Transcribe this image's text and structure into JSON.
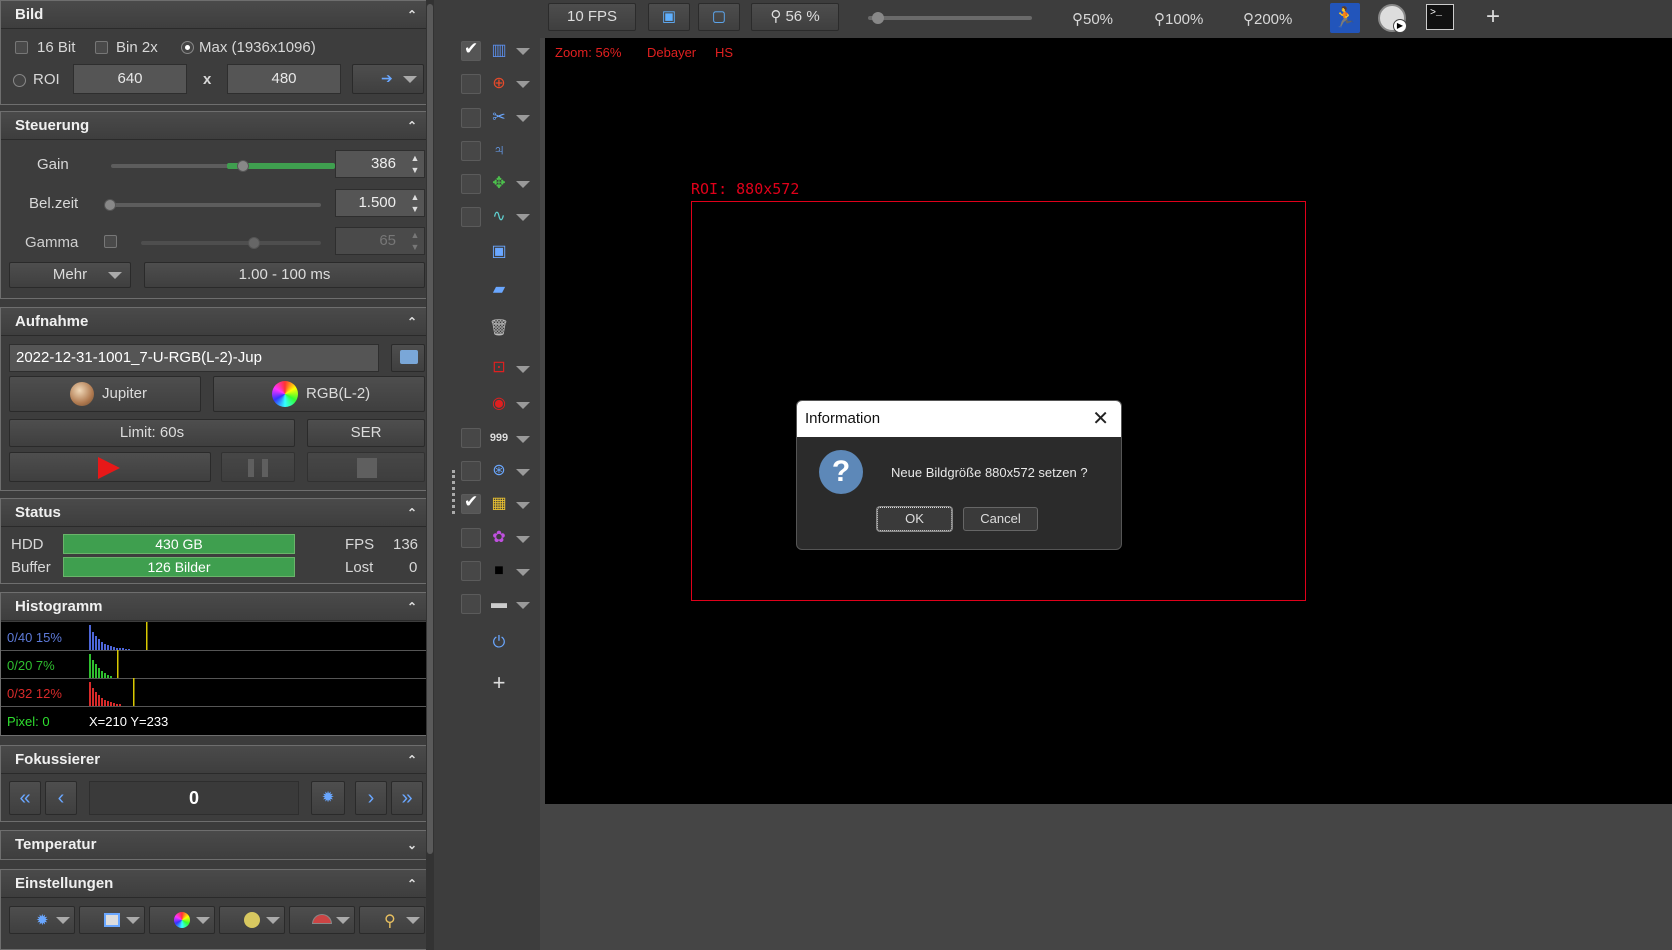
{
  "bild": {
    "title": "Bild",
    "bit16": "16 Bit",
    "bin2x": "Bin 2x",
    "max": "Max (1936x1096)",
    "roi": "ROI",
    "roi_w": "640",
    "x": "x",
    "roi_h": "480"
  },
  "steuerung": {
    "title": "Steuerung",
    "gain_label": "Gain",
    "gain_value": "386",
    "gain_level": 0.68,
    "belzeit_label": "Bel.zeit",
    "belzeit_value": "1.500",
    "belzeit_level": 0.0,
    "gamma_label": "Gamma",
    "gamma_value": "65",
    "gamma_level": 0.63,
    "mehr": "Mehr",
    "range": "1.00 - 100 ms"
  },
  "aufnahme": {
    "title": "Aufnahme",
    "filename": "2022-12-31-1001_7-U-RGB(L-2)-Jup",
    "object": "Jupiter",
    "filter": "RGB(L-2)",
    "limit": "Limit: 60s",
    "format": "SER"
  },
  "status": {
    "title": "Status",
    "hdd_label": "HDD",
    "hdd_value": "430 GB",
    "fps_label": "FPS",
    "fps_value": "136",
    "buffer_label": "Buffer",
    "buffer_value": "126 Bilder",
    "lost_label": "Lost",
    "lost_value": "0"
  },
  "histogramm": {
    "title": "Histogramm",
    "blue": "0/40 15%",
    "green": "0/20 7%",
    "red": "0/32 12%",
    "pixel": "Pixel: 0",
    "coords": "X=210 Y=233"
  },
  "fokussierer": {
    "title": "Fokussierer",
    "value": "0"
  },
  "temperatur": {
    "title": "Temperatur"
  },
  "einstellungen": {
    "title": "Einstellungen"
  },
  "toolbar": {
    "fps": "10 FPS",
    "zoom": "56 %",
    "z50": "50%",
    "z100": "100%",
    "z200": "200%",
    "plus": "+"
  },
  "view": {
    "zoom_info": "Zoom: 56%",
    "debayer": "Debayer",
    "hs": "HS",
    "roi_label": "ROI: 880x572"
  },
  "dialog": {
    "title": "Information",
    "message": "Neue Bildgröße 880x572 setzen ?",
    "ok": "OK",
    "cancel": "Cancel"
  },
  "colors": {
    "accent_green": "#3f9f4f",
    "roi_red": "#e0001a",
    "overlay_red": "#e02020"
  }
}
